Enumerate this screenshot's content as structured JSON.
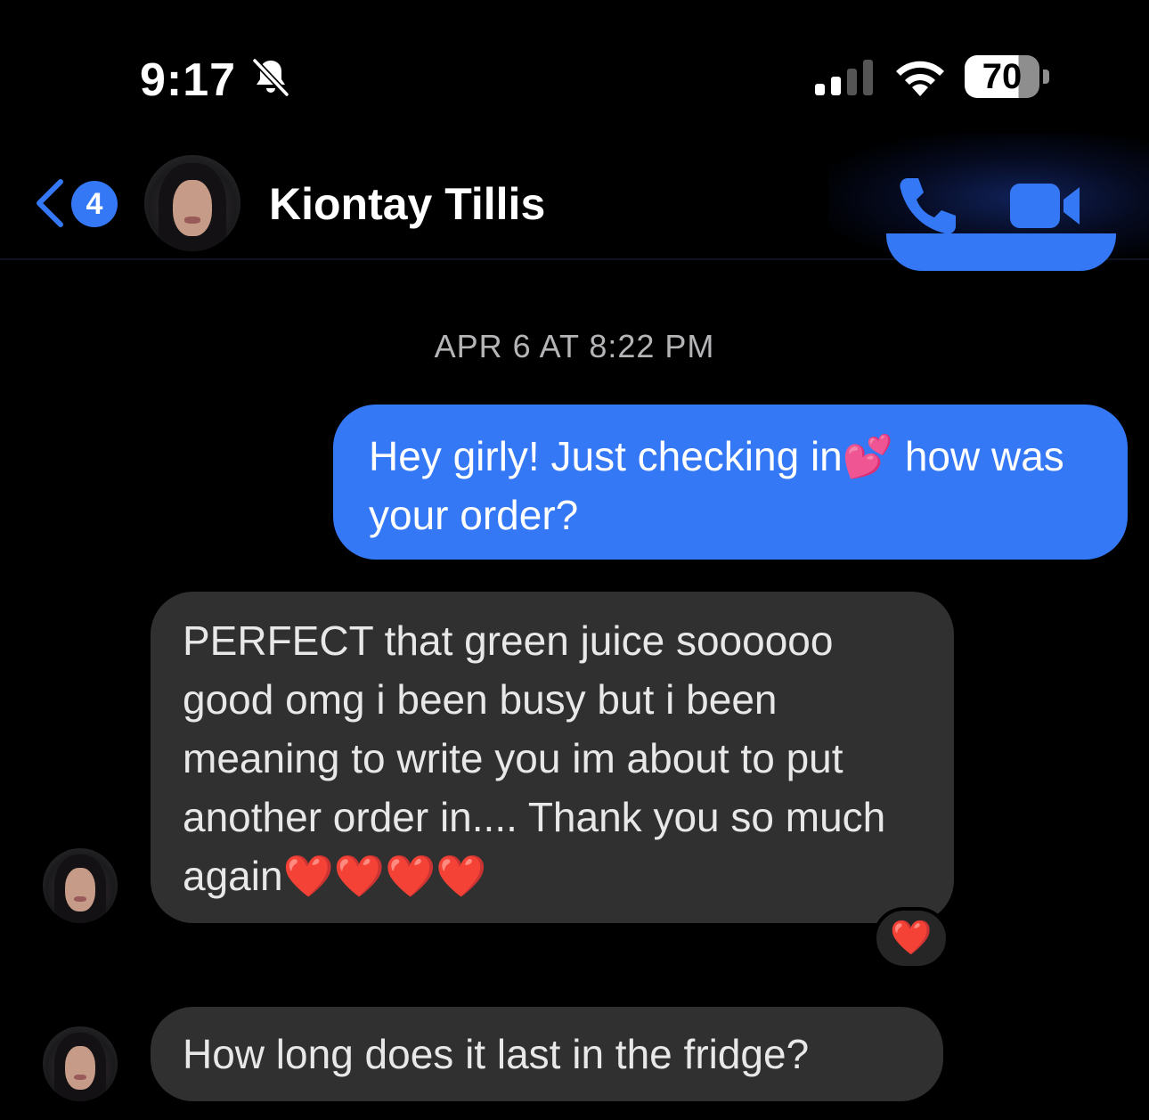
{
  "status_bar": {
    "time": "9:17",
    "battery": "70",
    "icons": [
      "bell-slash-icon",
      "signal-icon",
      "wifi-icon",
      "battery-icon"
    ]
  },
  "header": {
    "unread_count": "4",
    "contact_name": "Kiontay Tillis",
    "icons": [
      "chevron-left-icon",
      "phone-icon",
      "video-icon"
    ],
    "accent_color": "#3478f6"
  },
  "conversation": {
    "timestamp": "APR 6 AT 8:22 PM",
    "messages": [
      {
        "direction": "outgoing",
        "text": "Hey girly! Just checking in💕 how was your order?"
      },
      {
        "direction": "incoming",
        "text": "PERFECT that green juice soooooo good omg i been busy but i been meaning to write you im about to put another order in.... Thank you so much again❤️❤️❤️❤️",
        "reaction": "❤️"
      },
      {
        "direction": "incoming",
        "text": "How long does it last in the fridge?"
      }
    ]
  },
  "colors": {
    "outgoing_bubble": "#3478f6",
    "incoming_bubble": "#303030",
    "background": "#000000"
  }
}
